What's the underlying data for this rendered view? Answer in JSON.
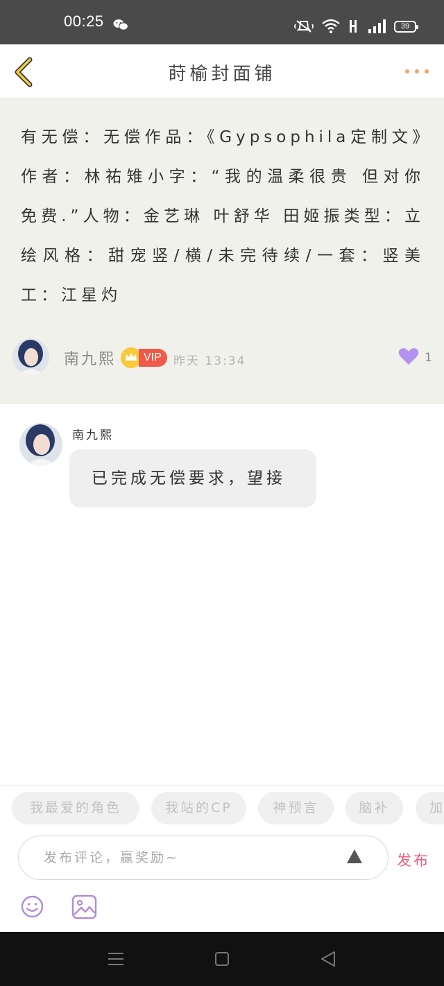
{
  "status_bar": {
    "time": "00:25",
    "battery": "39"
  },
  "header": {
    "title": "莳榆封面铺"
  },
  "post": {
    "text": "有无偿：无偿作品：《Gypsophila定制文》作者：林祐雉小字：“我的温柔很贵 但对你免费.”人物：金艺琳 叶舒华 田姬振类型：立绘风格：甜宠竖/横/未完待续/一套：竖美工：江星灼",
    "author_name": "南九熙",
    "vip_label": "VIP",
    "time": "昨天 13:34",
    "like_count": "1"
  },
  "comment": {
    "author_name": "南九熙",
    "text": "已完成无偿要求，望接"
  },
  "bottom": {
    "chips": [
      "我最爱的角色",
      "我站的CP",
      "神预言",
      "脑补",
      "加"
    ],
    "input_placeholder": "发布评论，赢奖励~",
    "publish_label": "发布"
  },
  "colors": {
    "accent_pink": "#ee5f7d",
    "heart_purple": "#b592f0",
    "vip_red": "#f05a4a",
    "back_yellow": "#f3cc3f",
    "more_orange": "#f0a56a"
  },
  "icons": [
    "wechat-icon",
    "mute-icon",
    "wifi-icon",
    "hd-icon",
    "signal-icon",
    "battery-icon",
    "back-icon",
    "more-icon",
    "crown-icon",
    "heart-icon",
    "send-arrow-icon",
    "emoji-icon",
    "image-icon",
    "menu-icon",
    "home-icon",
    "back-nav-icon"
  ]
}
